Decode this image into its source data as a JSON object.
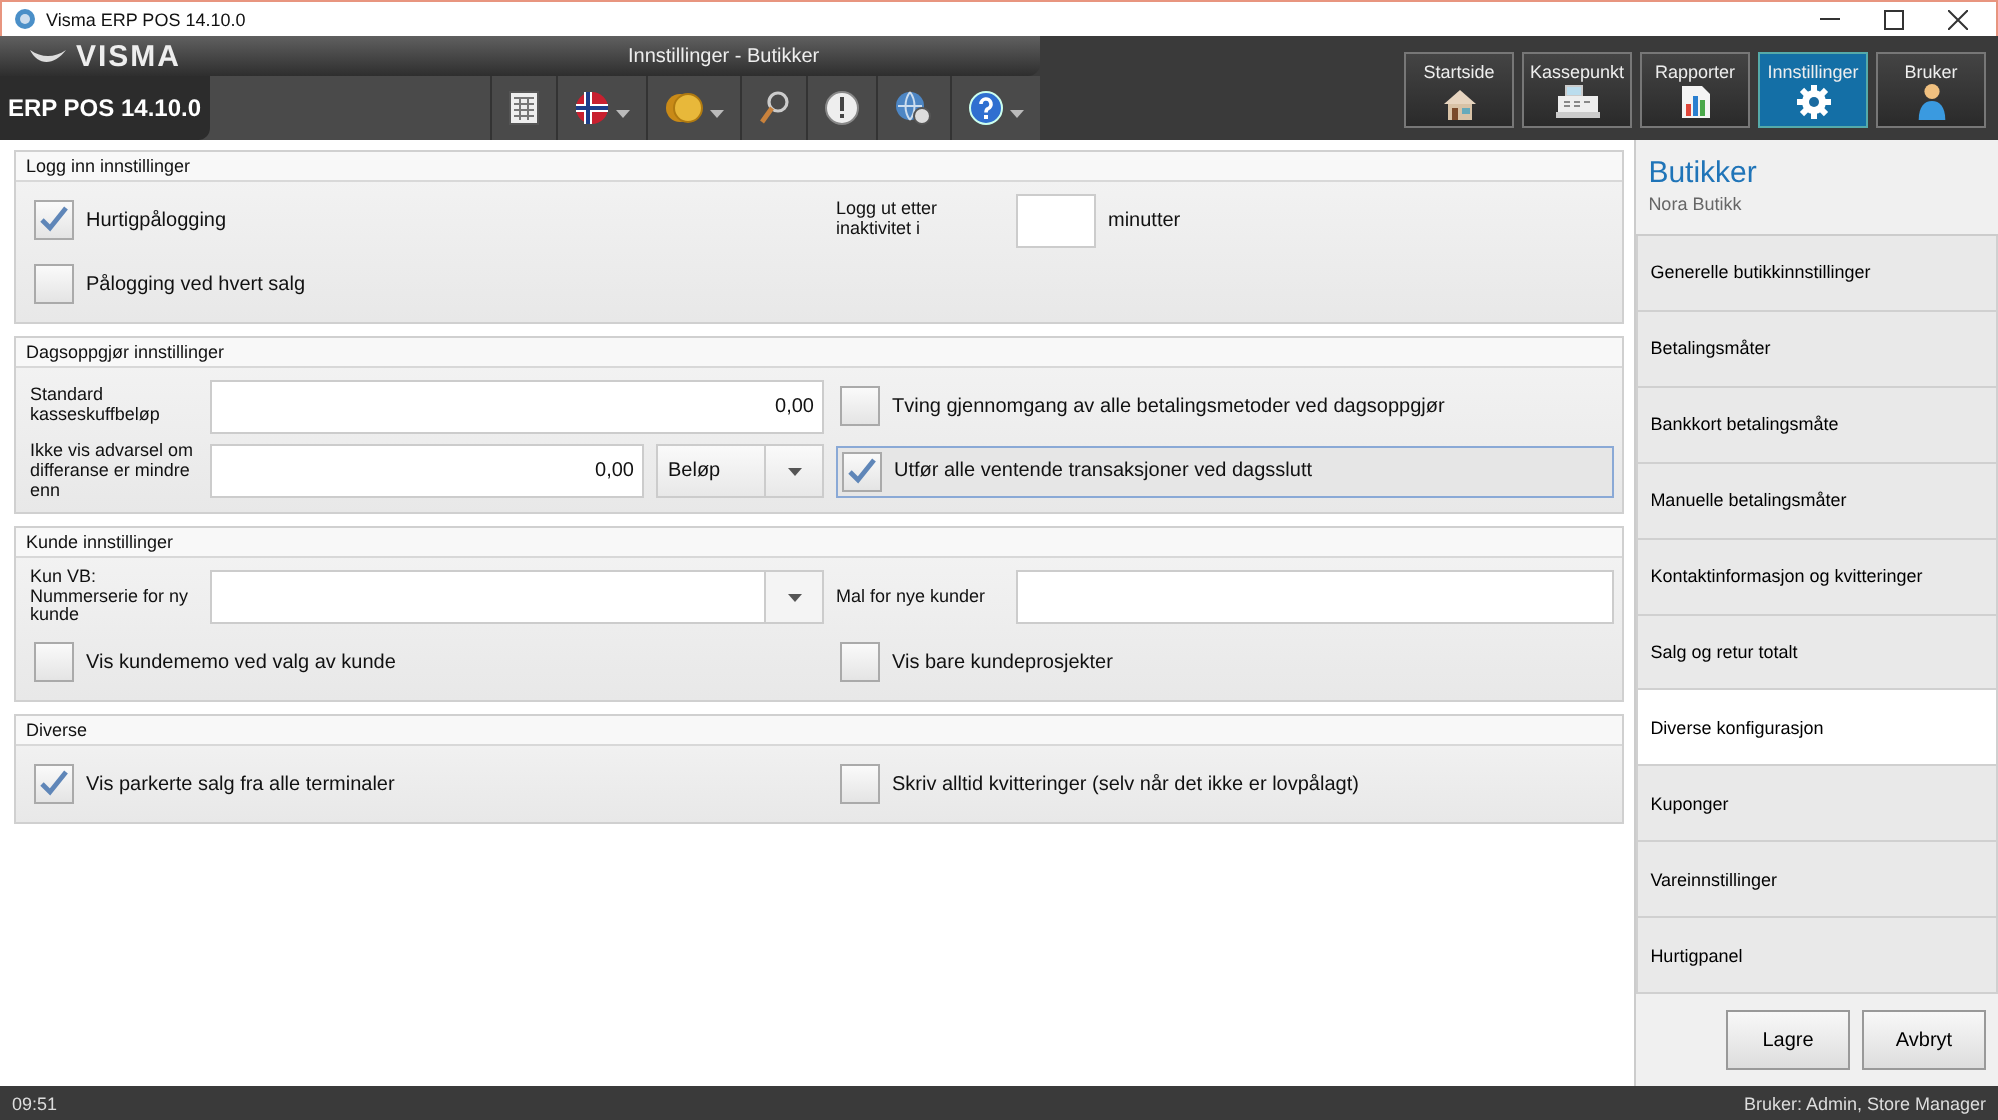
{
  "window": {
    "title": "Visma ERP POS 14.10.0"
  },
  "header": {
    "logo": "VISMA",
    "page_title": "Innstillinger - Butikker",
    "product": "ERP POS 14.10.0",
    "toolbar": [
      {
        "kind": "calculator",
        "dropdown": false
      },
      {
        "kind": "flag",
        "dropdown": true
      },
      {
        "kind": "coins",
        "dropdown": true
      },
      {
        "kind": "search",
        "dropdown": false
      },
      {
        "kind": "alert",
        "dropdown": false
      },
      {
        "kind": "sync",
        "dropdown": false
      },
      {
        "kind": "help",
        "dropdown": true
      }
    ],
    "nav": [
      {
        "label": "Startside",
        "kind": "house",
        "selected": false
      },
      {
        "label": "Kassepunkt",
        "kind": "register",
        "selected": false
      },
      {
        "label": "Rapporter",
        "kind": "report",
        "selected": false
      },
      {
        "label": "Innstillinger",
        "kind": "gear",
        "selected": true
      },
      {
        "label": "Bruker",
        "kind": "user",
        "selected": false
      }
    ]
  },
  "sections": [
    {
      "title": "Logg inn innstillinger",
      "rows": [
        {
          "left": {
            "kind": "checkbox",
            "label": "Hurtigpålogging",
            "checked": true,
            "focused": false
          },
          "right": {
            "kind": "field",
            "label": "Logg ut etter inaktivitet i",
            "dropdown": false,
            "suffix": "minutter"
          }
        },
        {
          "left": {
            "kind": "checkbox",
            "label": "Pålogging ved hvert salg",
            "checked": false,
            "focused": false
          }
        }
      ]
    },
    {
      "title": "Dagsoppgjør innstillinger",
      "rows": [
        {
          "left": {
            "kind": "field",
            "label": "Standard kasseskuffbeløp",
            "value": "0,00",
            "dropdown": false
          },
          "right": {
            "kind": "checkbox",
            "label": "Tving gjennomgang av alle betalingsmetoder ved dagsoppgjør",
            "checked": false,
            "focused": false
          }
        },
        {
          "left": {
            "kind": "field",
            "label": "Ikke vis advarsel om differanse er mindre enn",
            "value": "0,00",
            "dropdown": false,
            "select": "Beløp"
          },
          "right": {
            "kind": "checkbox",
            "label": "Utfør alle ventende transaksjoner ved dagsslutt",
            "checked": true,
            "focused": true
          }
        }
      ]
    },
    {
      "title": "Kunde innstillinger",
      "rows": [
        {
          "left": {
            "kind": "field",
            "label": "Kun VB: Nummerserie for ny kunde",
            "dropdown": true
          },
          "right": {
            "kind": "field",
            "label": "Mal for nye kunder",
            "dropdown": false
          }
        },
        {
          "left": {
            "kind": "checkbox",
            "label": "Vis kundememo ved valg av kunde",
            "checked": false,
            "focused": false
          },
          "right": {
            "kind": "checkbox",
            "label": "Vis bare kundeprosjekter",
            "checked": false,
            "focused": false
          }
        }
      ]
    },
    {
      "title": "Diverse",
      "rows": [
        {
          "left": {
            "kind": "checkbox",
            "label": "Vis parkerte salg fra alle terminaler",
            "checked": true,
            "focused": false
          },
          "right": {
            "kind": "checkbox",
            "label": "Skriv alltid kvitteringer (selv når det ikke er lovpålagt)",
            "checked": false,
            "focused": false
          }
        }
      ]
    }
  ],
  "sidebar": {
    "title": "Butikker",
    "subtitle": "Nora Butikk",
    "items": [
      {
        "label": "Generelle butikkinnstillinger",
        "selected": false
      },
      {
        "label": "Betalingsmåter",
        "selected": false
      },
      {
        "label": "Bankkort betalingsmåte",
        "selected": false
      },
      {
        "label": "Manuelle betalingsmåter",
        "selected": false
      },
      {
        "label": "Kontaktinformasjon og kvitteringer",
        "selected": false
      },
      {
        "label": "Salg og retur totalt",
        "selected": false
      },
      {
        "label": "Diverse konfigurasjon",
        "selected": true
      },
      {
        "label": "Kuponger",
        "selected": false
      },
      {
        "label": "Vareinnstillinger",
        "selected": false
      },
      {
        "label": "Hurtigpanel",
        "selected": false
      }
    ]
  },
  "buttons": [
    "Lagre",
    "Avbryt"
  ],
  "status_bar": {
    "time": "09:51",
    "user": "Bruker: Admin, Store Manager"
  }
}
